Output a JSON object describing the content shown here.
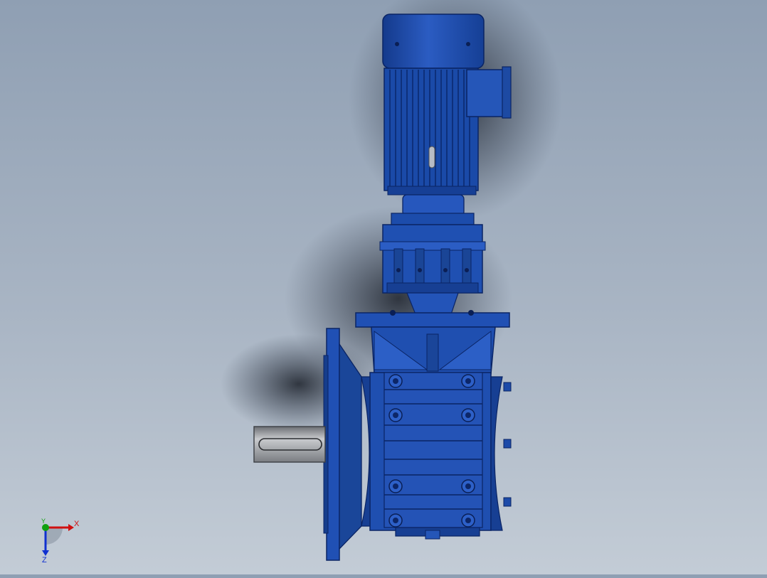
{
  "viewport": {
    "model": "gear-motor",
    "view": "front",
    "colors": {
      "background_top": "#8f9fb3",
      "background_bottom": "#c3ccd6",
      "body_blue": "#1f4fb0",
      "dark_blue": "#0f2f78",
      "light_blue": "#3f70cf",
      "shaft_grey": "#a4a7ab"
    }
  },
  "triad": {
    "x_label": "X",
    "y_label": "Y",
    "z_label": "Z",
    "x_color": "#d01010",
    "y_color": "#10a010",
    "z_color": "#1030d0"
  }
}
